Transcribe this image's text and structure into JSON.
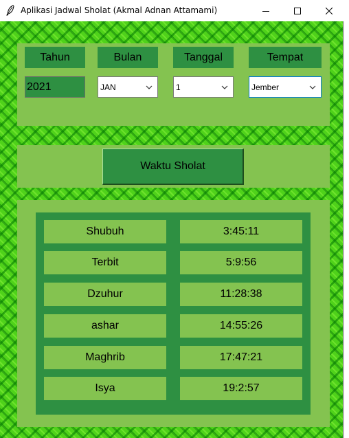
{
  "window": {
    "title": "Aplikasi Jadwal Sholat (Akmal Adnan Attamami)",
    "icons": {
      "app": "feather-icon",
      "minimize": "minimize-icon",
      "maximize": "maximize-icon",
      "close": "close-icon"
    }
  },
  "colors": {
    "panel": "#84c350",
    "dark_green": "#2e9042",
    "background_green": "#4fd21a",
    "focus": "#0078d7"
  },
  "form": {
    "headers": {
      "year": "Tahun",
      "month": "Bulan",
      "day": "Tanggal",
      "place": "Tempat"
    },
    "year_value": "2021",
    "month_value": "JAN",
    "day_value": "1",
    "place_value": "Jember"
  },
  "action": {
    "button_label": "Waktu Sholat"
  },
  "prayer_times": [
    {
      "name": "Shubuh",
      "time": "3:45:11"
    },
    {
      "name": "Terbit",
      "time": "5:9:56"
    },
    {
      "name": "Dzuhur",
      "time": "11:28:38"
    },
    {
      "name": "ashar",
      "time": "14:55:26"
    },
    {
      "name": "Maghrib",
      "time": "17:47:21"
    },
    {
      "name": "Isya",
      "time": "19:2:57"
    }
  ]
}
